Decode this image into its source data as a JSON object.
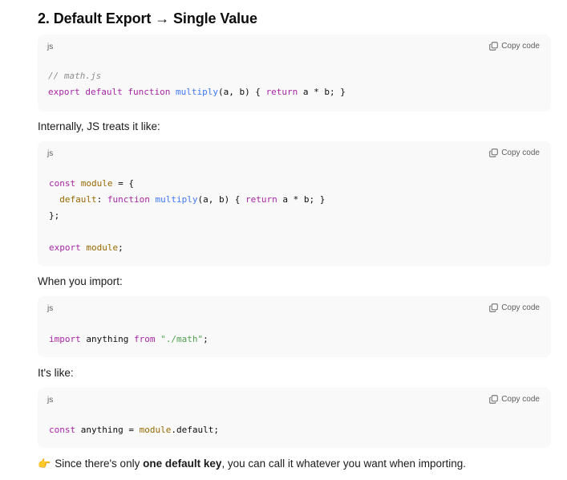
{
  "heading": "2. Default Export → Single Value",
  "copy_label": "Copy code",
  "lang": "js",
  "blocks": [
    {
      "lines": [
        {
          "tokens": [
            {
              "t": "// math.js",
              "c": "cm"
            }
          ]
        },
        {
          "tokens": [
            {
              "t": "export",
              "c": "kw"
            },
            {
              "t": " "
            },
            {
              "t": "default",
              "c": "kw"
            },
            {
              "t": " "
            },
            {
              "t": "function",
              "c": "kw"
            },
            {
              "t": " "
            },
            {
              "t": "multiply",
              "c": "fn"
            },
            {
              "t": "(a, b) { "
            },
            {
              "t": "return",
              "c": "kw"
            },
            {
              "t": " a * b; }"
            }
          ]
        }
      ]
    },
    {
      "lines": [
        {
          "tokens": [
            {
              "t": "const",
              "c": "kw"
            },
            {
              "t": " "
            },
            {
              "t": "module",
              "c": "id"
            },
            {
              "t": " = {"
            }
          ]
        },
        {
          "tokens": [
            {
              "t": "  "
            },
            {
              "t": "default",
              "c": "id"
            },
            {
              "t": ": "
            },
            {
              "t": "function",
              "c": "kw"
            },
            {
              "t": " "
            },
            {
              "t": "multiply",
              "c": "fn"
            },
            {
              "t": "(a, b) { "
            },
            {
              "t": "return",
              "c": "kw"
            },
            {
              "t": " a * b; }"
            }
          ]
        },
        {
          "tokens": [
            {
              "t": "};"
            }
          ]
        },
        {
          "tokens": []
        },
        {
          "tokens": [
            {
              "t": "export",
              "c": "kw"
            },
            {
              "t": " "
            },
            {
              "t": "module",
              "c": "id"
            },
            {
              "t": ";"
            }
          ]
        }
      ]
    },
    {
      "lines": [
        {
          "tokens": [
            {
              "t": "import",
              "c": "kw"
            },
            {
              "t": " anything "
            },
            {
              "t": "from",
              "c": "kw"
            },
            {
              "t": " "
            },
            {
              "t": "\"./math\"",
              "c": "str"
            },
            {
              "t": ";"
            }
          ]
        }
      ]
    },
    {
      "lines": [
        {
          "tokens": [
            {
              "t": "const",
              "c": "kw"
            },
            {
              "t": " anything = "
            },
            {
              "t": "module",
              "c": "id"
            },
            {
              "t": ".default;"
            }
          ]
        }
      ]
    }
  ],
  "paragraphs": {
    "p1": "Internally, JS treats it like:",
    "p2": "When you import:",
    "p3": "It's like:",
    "final_emoji": "👉",
    "final_pre": "Since there's only ",
    "final_bold": "one default key",
    "final_post": ", you can call it whatever you want when importing."
  }
}
